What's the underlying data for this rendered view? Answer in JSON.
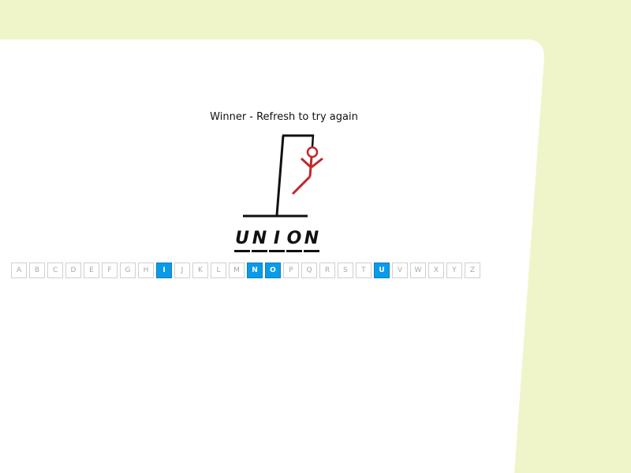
{
  "status": {
    "message": "Winner - Refresh to try again"
  },
  "word": {
    "letters": [
      "U",
      "N",
      "I",
      "O",
      "N"
    ]
  },
  "keyboard": {
    "keys": [
      {
        "label": "A",
        "used": false
      },
      {
        "label": "B",
        "used": false
      },
      {
        "label": "C",
        "used": false
      },
      {
        "label": "D",
        "used": false
      },
      {
        "label": "E",
        "used": false
      },
      {
        "label": "F",
        "used": false
      },
      {
        "label": "G",
        "used": false
      },
      {
        "label": "H",
        "used": false
      },
      {
        "label": "I",
        "used": true
      },
      {
        "label": "J",
        "used": false
      },
      {
        "label": "K",
        "used": false
      },
      {
        "label": "L",
        "used": false
      },
      {
        "label": "M",
        "used": false
      },
      {
        "label": "N",
        "used": true
      },
      {
        "label": "O",
        "used": true
      },
      {
        "label": "P",
        "used": false
      },
      {
        "label": "Q",
        "used": false
      },
      {
        "label": "R",
        "used": false
      },
      {
        "label": "S",
        "used": false
      },
      {
        "label": "T",
        "used": false
      },
      {
        "label": "U",
        "used": true
      },
      {
        "label": "V",
        "used": false
      },
      {
        "label": "W",
        "used": false
      },
      {
        "label": "X",
        "used": false
      },
      {
        "label": "Y",
        "used": false
      },
      {
        "label": "Z",
        "used": false
      }
    ]
  },
  "colors": {
    "background": "#f0f5c9",
    "panel": "#ffffff",
    "used_key": "#0a9be8",
    "figure": "#c0282a"
  }
}
